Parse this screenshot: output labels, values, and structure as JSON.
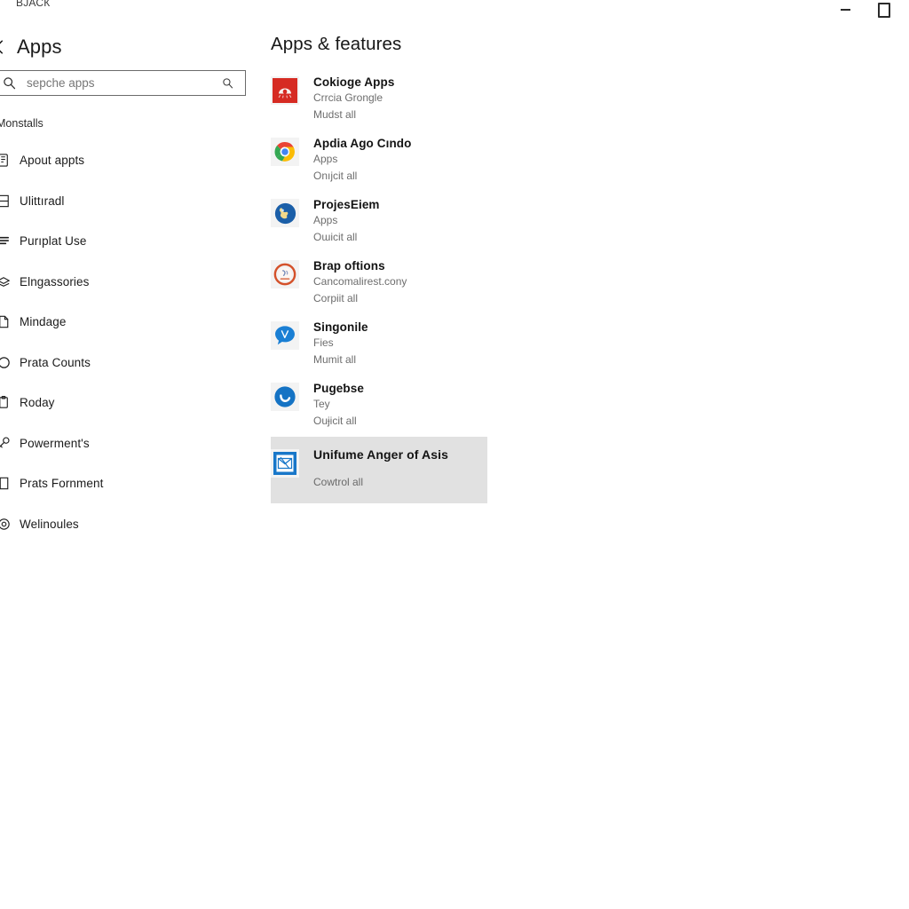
{
  "window": {
    "app_label": "ВЈАСК",
    "minimize_label": "Minimize",
    "maximize_label": "Maximize"
  },
  "sidebar": {
    "back_label": "Back",
    "title": "Apps",
    "search": {
      "placeholder": "sepche apps",
      "value": "",
      "left_icon": "search-icon",
      "right_icon": "search-icon"
    },
    "section_label": "Monstalls",
    "items": [
      {
        "label": "Apout appts",
        "icon": "apps-icon"
      },
      {
        "label": "Ulittıradl",
        "icon": "list-icon"
      },
      {
        "label": "Purıplat Use",
        "icon": "lines-icon"
      },
      {
        "label": "Elngassories",
        "icon": "stack-icon"
      },
      {
        "label": "Mindage",
        "icon": "document-icon"
      },
      {
        "label": "Prata Counts",
        "icon": "circle-icon"
      },
      {
        "label": "Roday",
        "icon": "clipboard-icon"
      },
      {
        "label": "Powerment's",
        "icon": "key-icon"
      },
      {
        "label": "Prats Fornment",
        "icon": "page-icon"
      },
      {
        "label": "Welinoules",
        "icon": "ring-icon"
      }
    ]
  },
  "main": {
    "title": "Apps & features",
    "apps": [
      {
        "name": "Cokioge Apps",
        "publisher": "Crrcia Grongle",
        "meta": "Mudst all",
        "icon": "red-app-icon",
        "icon_color": "#d62b23",
        "selected": false
      },
      {
        "name": "Apdia Ago Cındo",
        "publisher": "Apps",
        "meta": "Onıjcit all",
        "icon": "chrome-icon",
        "icon_color": "#4285f4",
        "selected": false
      },
      {
        "name": "ProjesЕiem",
        "publisher": "Apps",
        "meta": "Oɯicit all",
        "icon": "blue-globe-icon",
        "icon_color": "#1b5fa8",
        "selected": false
      },
      {
        "name": "Brap oftions",
        "publisher": "Cancomalirest.cony",
        "meta": "Corpiit all",
        "icon": "orange-ring-icon",
        "icon_color": "#d4512a",
        "selected": false
      },
      {
        "name": "Singonile",
        "publisher": "Fies",
        "meta": "Mumit all",
        "icon": "blue-bubble-icon",
        "icon_color": "#1a7fd4",
        "selected": false
      },
      {
        "name": "Pugeƅse",
        "publisher": "Tey",
        "meta": "Ouɉicit all",
        "icon": "blue-check-circle-icon",
        "icon_color": "#1573c4",
        "selected": false
      },
      {
        "name": "Unifume Anger of Asis",
        "publisher": "",
        "meta": "Cowtrol all",
        "icon": "blue-square-mail-icon",
        "icon_color": "#1877c9",
        "selected": true
      }
    ]
  },
  "colors": {
    "selection_background": "#e1e1e1",
    "icon_tile_background": "#f3f3f3",
    "secondary_text": "#6d6d6d"
  }
}
